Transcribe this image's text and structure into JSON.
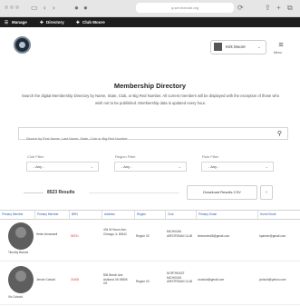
{
  "browser": {
    "address": "q.serviceclub.org"
  },
  "adminbar": {
    "items": [
      "Manage",
      "Directory",
      "Club Moore"
    ]
  },
  "header": {
    "user_name": "Kirk Moore",
    "menu_label": "Menu"
  },
  "page": {
    "title": "Membership Directory",
    "intro": "Search the digital Membership Directory by Name, State, Club, or Big Red Number. All current members will be displayed with the exception of those who wish not to be published. Membership data is updated every hour."
  },
  "search": {
    "placeholder": "Search by First Name, Last Name, State, Club or Big Red Number"
  },
  "filters": [
    {
      "label": "Club Filter",
      "value": "- Any -"
    },
    {
      "label": "Region Filter",
      "value": "- Any -"
    },
    {
      "label": "Role Filter",
      "value": "- Any -"
    }
  ],
  "results": {
    "count_text": "8523 Results",
    "download_label": "Download Results CSV"
  },
  "table": {
    "headers": [
      "Primary Member",
      "Primary Member",
      "BRN",
      "Address",
      "Region",
      "Club",
      "Primary Email",
      "Home Email"
    ],
    "rows": [
      {
        "name_under_photo": "Timothy Barnes",
        "member2": "Helen Amarosell",
        "brn": "55701",
        "address": "434 W Huron Ave, Chicago, IL 60642",
        "region": "Region 03",
        "club": "MICHIGAN AIRSTREAM CLUB",
        "email": "timbarnes56@gmail.com",
        "home_email": "hpalmer@gmail.com"
      },
      {
        "name_under_photo": "Vic Colsold",
        "member2": "Jennie Colsold",
        "brn": "21408",
        "address": "806 Beech Ave, Ashland, MI 49806 US",
        "region": "Region 03",
        "club": "NORTHEAST MICHIGAN AIRSTREAM CLUB",
        "email": "vcolsold@gmail.com",
        "home_email": "jcolsold@yahoo.com"
      }
    ]
  },
  "colors": {
    "adminbar": "#1e1e1e",
    "link_blue": "#2a5db0",
    "brn_red": "#d93434"
  }
}
